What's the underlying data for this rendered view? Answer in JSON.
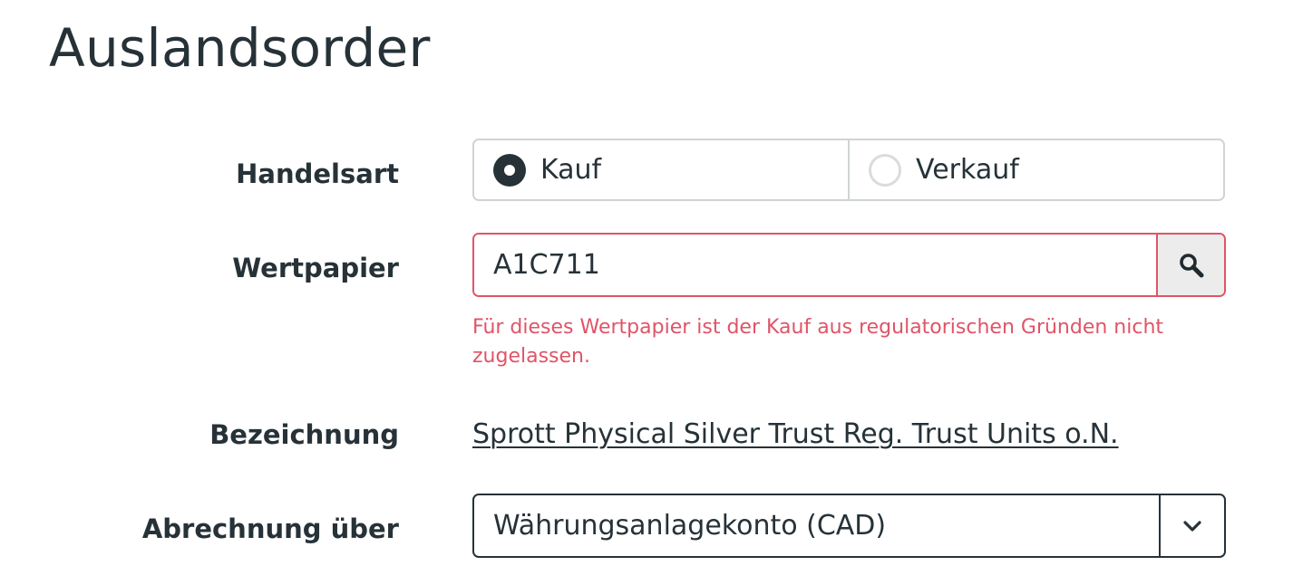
{
  "page": {
    "title": "Auslandsorder"
  },
  "form": {
    "trade_type": {
      "label": "Handelsart",
      "options": [
        {
          "label": "Kauf",
          "selected": true
        },
        {
          "label": "Verkauf",
          "selected": false
        }
      ]
    },
    "security": {
      "label": "Wertpapier",
      "value": "A1C711",
      "search_icon": "search-icon",
      "error": "Für dieses Wertpapier ist der Kauf aus regulatorischen Gründen nicht zugelassen."
    },
    "name": {
      "label": "Bezeichnung",
      "value": "Sprott Physical Silver Trust Reg. Trust Units o.N."
    },
    "settlement": {
      "label": "Abrechnung über",
      "selected": "Währungsanlagekonto (CAD)",
      "toggle_icon": "chevron-down-icon"
    }
  },
  "colors": {
    "text": "#263238",
    "error": "#e05468",
    "border": "#cfd4d6",
    "button_bg": "#ececec"
  }
}
